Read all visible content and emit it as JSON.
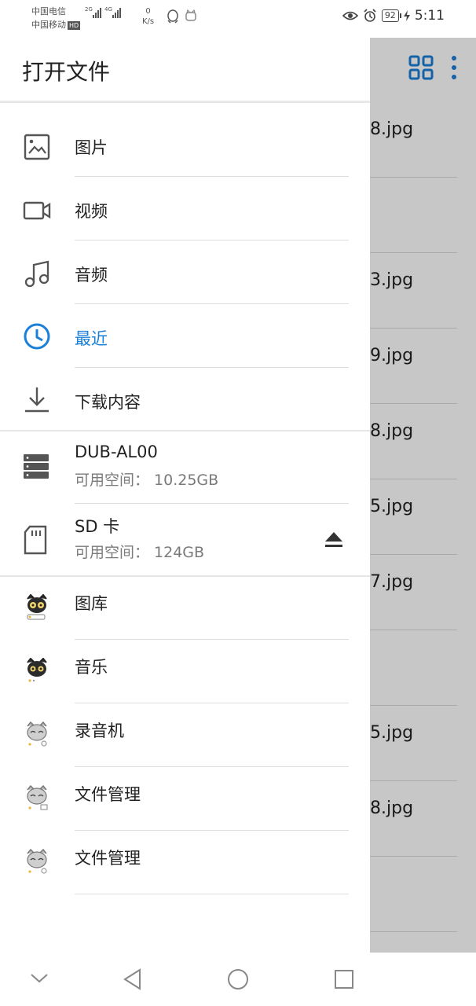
{
  "status_bar": {
    "carrier1": "中国电信",
    "carrier2": "中国移动",
    "hd": "HD",
    "net1": "2G",
    "net2": "4G",
    "speed_value": "0",
    "speed_unit": "K/s",
    "battery": "92",
    "time": "5:11"
  },
  "drawer": {
    "title": "打开文件",
    "items": [
      {
        "label": "图片",
        "icon": "image-icon"
      },
      {
        "label": "视频",
        "icon": "video-icon"
      },
      {
        "label": "音频",
        "icon": "music-note-icon"
      },
      {
        "label": "最近",
        "icon": "clock-icon",
        "active": true
      },
      {
        "label": "下载内容",
        "icon": "download-icon"
      }
    ],
    "storage": [
      {
        "label": "DUB-AL00",
        "sub": "可用空间： 10.25GB",
        "icon": "storage-icon"
      },
      {
        "label": "SD 卡",
        "sub": "可用空间： 124GB",
        "icon": "sd-card-icon",
        "eject_icon": "eject-icon"
      }
    ],
    "apps": [
      {
        "label": "图库"
      },
      {
        "label": "音乐"
      },
      {
        "label": "录音机"
      },
      {
        "label": "文件管理"
      },
      {
        "label": "文件管理"
      }
    ]
  },
  "background_list": [
    "8.jpg",
    "3.jpg",
    "9.jpg",
    "8.jpg",
    "5.jpg",
    "7.jpg",
    "5.jpg",
    "8.jpg"
  ],
  "colors": {
    "accent": "#1a7fd9",
    "scrim": "#000000"
  }
}
